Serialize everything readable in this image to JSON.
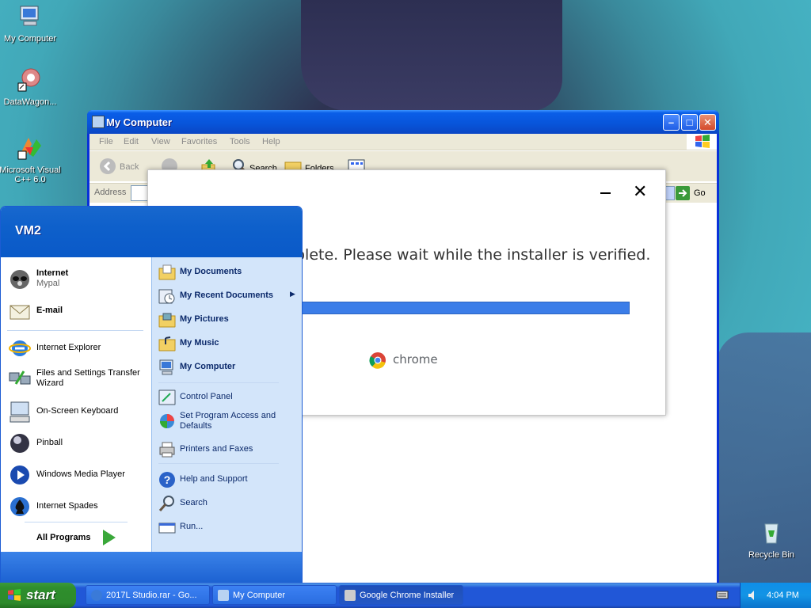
{
  "desktop": {
    "icons": [
      {
        "label": "My Computer"
      },
      {
        "label": "DataWagon..."
      },
      {
        "label": "Microsoft Visual C++ 6.0"
      },
      {
        "label": "Recycle Bin"
      }
    ]
  },
  "window": {
    "title": "My Computer",
    "menu": [
      "File",
      "Edit",
      "View",
      "Favorites",
      "Tools",
      "Help"
    ],
    "toolbar": {
      "back": "Back",
      "search": "Search",
      "folders": "Folders"
    },
    "address_label": "Address",
    "go_label": "Go"
  },
  "installer": {
    "message": "plete. Please wait while the installer is verified.",
    "brand": "chrome",
    "progress": 1.0
  },
  "start_menu": {
    "user": "VM2",
    "pinned": [
      {
        "label": "Internet",
        "sub": "Mypal"
      },
      {
        "label": "E-mail",
        "sub": ""
      }
    ],
    "recent": [
      {
        "label": "Internet Explorer"
      },
      {
        "label": "Files and Settings Transfer Wizard"
      },
      {
        "label": "On-Screen Keyboard"
      },
      {
        "label": "Pinball"
      },
      {
        "label": "Windows Media Player"
      },
      {
        "label": "Internet Spades"
      }
    ],
    "all_programs": "All Programs",
    "right": [
      {
        "label": "My Documents"
      },
      {
        "label": "My Recent Documents"
      },
      {
        "label": "My Pictures"
      },
      {
        "label": "My Music"
      },
      {
        "label": "My Computer"
      },
      {
        "label": "Control Panel"
      },
      {
        "label": "Set Program Access and Defaults"
      },
      {
        "label": "Printers and Faxes"
      },
      {
        "label": "Help and Support"
      },
      {
        "label": "Search"
      },
      {
        "label": "Run..."
      }
    ]
  },
  "taskbar": {
    "start_label": "start",
    "tasks": [
      {
        "label": "2017L Studio.rar - Go..."
      },
      {
        "label": "My Computer"
      },
      {
        "label": "Google Chrome Installer"
      }
    ],
    "clock": "4:04 PM"
  },
  "colors": {
    "xp_blue": "#0a5ee8",
    "start_green": "#2f8e2d",
    "progress_blue": "#3b7de8"
  }
}
